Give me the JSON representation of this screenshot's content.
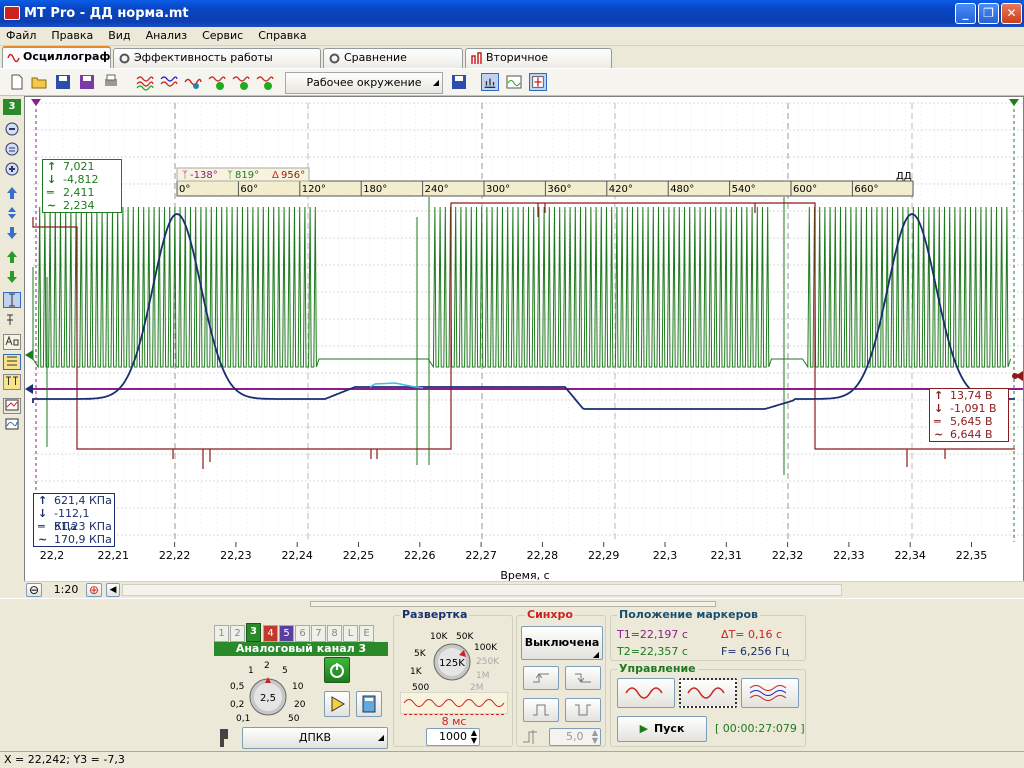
{
  "window": {
    "title": "MT Pro - ДД норма.mt"
  },
  "menu": [
    "Файл",
    "Правка",
    "Вид",
    "Анализ",
    "Сервис",
    "Справка"
  ],
  "tabs": [
    "Осциллограф",
    "Эффективность работы цилиндров",
    "Сравнение цилиндров",
    "Вторичное напряжение"
  ],
  "toolbar": {
    "env_label": "Рабочее окружение"
  },
  "left_strip": {
    "channel_num": "3"
  },
  "plot": {
    "axis_title": "Время, с",
    "x_ticks": [
      "22,2",
      "22,21",
      "22,22",
      "22,23",
      "22,24",
      "22,25",
      "22,26",
      "22,27",
      "22,28",
      "22,29",
      "22,3",
      "22,31",
      "22,32",
      "22,33",
      "22,34",
      "22,35"
    ],
    "angle_bar": {
      "marker1": "-138°",
      "marker2": "819°",
      "delta": "956°",
      "label": "ДД",
      "ticks": [
        "0°",
        "60°",
        "120°",
        "180°",
        "240°",
        "300°",
        "360°",
        "420°",
        "480°",
        "540°",
        "600°",
        "660°"
      ]
    },
    "green_box": [
      "7,021",
      "-4,812",
      "2,411",
      "2,234"
    ],
    "red_box": [
      "13,74 В",
      "-1,091 В",
      "5,645 В",
      "6,644 В"
    ],
    "blue_box": [
      "621,4 КПа",
      "-112,1 КПа",
      "51,23 КПа",
      "170,9 КПа"
    ],
    "scale_label": "1:20"
  },
  "channels": {
    "buttons": [
      "1",
      "2",
      "3",
      "4",
      "5",
      "6",
      "7",
      "8",
      "L",
      "E"
    ],
    "active_title": "Аналоговый канал 3",
    "knob_value": "2,5",
    "knob_labels": [
      "0,1",
      "0,2",
      "0,5",
      "1",
      "2",
      "5",
      "10",
      "20",
      "50"
    ],
    "sensor": "ДПКВ"
  },
  "sweep": {
    "title": "Развертка",
    "knob_value": "125K",
    "knob_labels": [
      "500",
      "1K",
      "5K",
      "10K",
      "50K",
      "100K",
      "250K",
      "1M",
      "2M"
    ],
    "time": "8 мс",
    "points": "1000"
  },
  "sync": {
    "title": "Синхро",
    "mode": "Выключена",
    "level": "5,0"
  },
  "markers": {
    "title": "Положение маркеров",
    "t1": "T1=22,197 с",
    "dt": "ΔT= 0,16 с",
    "t2": "T2=22,357 с",
    "f": "F= 6,256 Гц"
  },
  "control": {
    "title": "Управление",
    "start": "Пуск",
    "timer": "[ 00:00:27:079 ]"
  },
  "status": {
    "text": "X = 22,242; Y3 = -7,3"
  },
  "colors": {
    "green": "#1e7a1e",
    "red": "#8b1a1a",
    "blue": "#1a2f6e",
    "magenta": "#8b1e8b"
  }
}
